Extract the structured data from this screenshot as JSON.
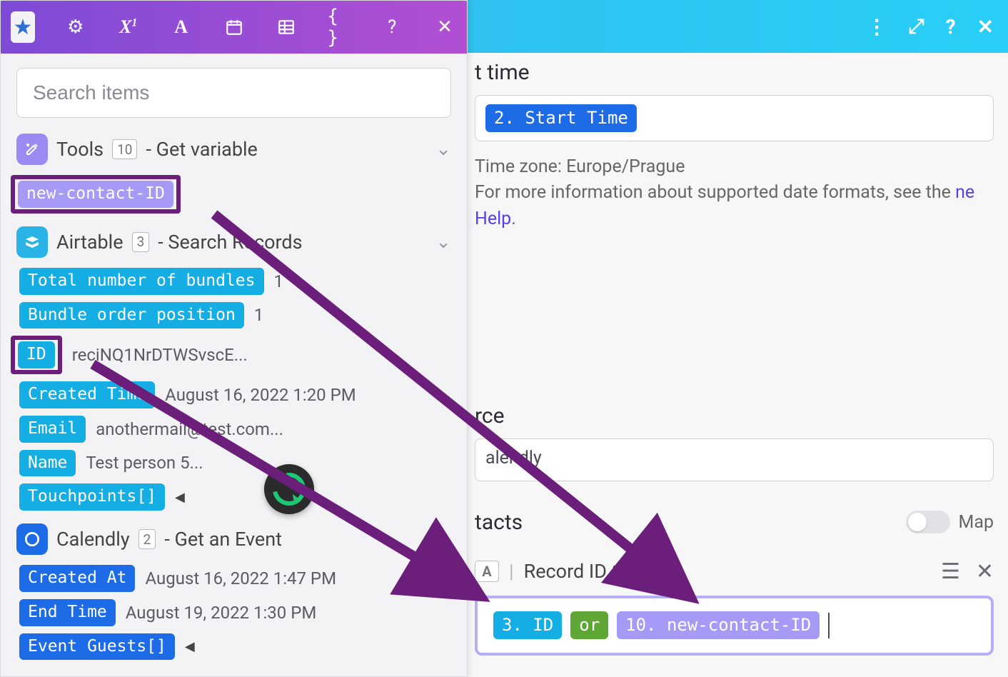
{
  "search": {
    "placeholder": "Search items"
  },
  "groups": {
    "tools": {
      "name": "Tools",
      "badge": "10",
      "suffix": " - Get variable",
      "var_pill": "new-contact-ID"
    },
    "airtable": {
      "name": "Airtable",
      "badge": "3",
      "suffix": " - Search Records",
      "rows": {
        "total": {
          "label": "Total number of bundles",
          "val": "1"
        },
        "order": {
          "label": "Bundle order position",
          "val": "1"
        },
        "id": {
          "label": "ID",
          "val": "reciNQ1NrDTWSvscE..."
        },
        "created": {
          "label": "Created Time",
          "val": "August 16, 2022 1:20 PM"
        },
        "email": {
          "label": "Email",
          "val": "anothermail@test.com..."
        },
        "name": {
          "label": "Name",
          "val": "Test person 5..."
        },
        "touch": {
          "label": "Touchpoints[]"
        }
      }
    },
    "calendly": {
      "name": "Calendly",
      "badge": "2",
      "suffix": " - Get an Event",
      "rows": {
        "createdAt": {
          "label": "Created At",
          "val": "August 16, 2022 1:47 PM"
        },
        "endTime": {
          "label": "End Time",
          "val": "August 19, 2022 1:30 PM"
        },
        "guests": {
          "label": "Event Guests[]"
        }
      }
    }
  },
  "right": {
    "topFieldSuffix": "t time",
    "startTimePill": "2. Start Time",
    "tz_line": "Time zone: Europe/Prague",
    "info_prefix": "For more information about supported date formats, see the ",
    "info_link": "ne Help",
    "sourceLabelSuffix": "rce",
    "sourceValue": "alendly",
    "contactsSuffix": "tacts",
    "mapLabel": "Map",
    "recordTitle": "Record ID 1",
    "pill_id": "3. ID",
    "pill_or": "or",
    "pill_new": "10. new-contact-ID"
  }
}
